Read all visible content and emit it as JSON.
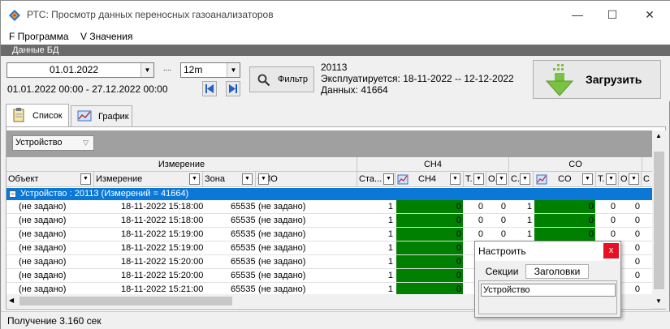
{
  "window": {
    "title": "РТС: Просмотр данных переносных газоанализаторов",
    "minimize": "—",
    "maximize": "☐",
    "close": "✕"
  },
  "menu": {
    "program": "F Программа",
    "values": "V Значения"
  },
  "section": {
    "title": "Данные БД"
  },
  "filter": {
    "date": "01.01.2022",
    "range_text": "01.01.2022 00:00 - 27.12.2022 00:00",
    "dots": "....",
    "period": "12m",
    "filter_label": "Фильтр"
  },
  "info": {
    "device": "20113",
    "exploit": "Эксплуатируется: 18-11-2022 -- 12-12-2022",
    "count": "Данных: 41664"
  },
  "load_button": {
    "label": "Загрузить"
  },
  "tabs": [
    {
      "label": "Список"
    },
    {
      "label": "График"
    }
  ],
  "grid": {
    "group_chip": "Устройство",
    "bands": {
      "measure": "Измерение",
      "ch4": "CH4",
      "co": "CO"
    },
    "columns": {
      "object": "Объект",
      "measure": "Измерение",
      "zone": "Зона",
      "fio": "ФИО",
      "status": "Ста...",
      "ch4": "CH4",
      "t": "T.",
      "o": "O.",
      "c": "C.",
      "co": "CO",
      "t2": "T.",
      "o2": "O",
      "c2": "C"
    },
    "group_row": "Устройство : 20113 (Измерений = 41664)",
    "rows": [
      {
        "object": "(не задано)",
        "time": "18-11-2022 15:18:00",
        "zone": "65535",
        "fio": "(не задано)",
        "st": "1",
        "ch4": "0",
        "t": "0",
        "o": "0",
        "c": "1",
        "co": "0",
        "t2": "0",
        "o2": "0"
      },
      {
        "object": "(не задано)",
        "time": "18-11-2022 15:18:00",
        "zone": "65535",
        "fio": "(не задано)",
        "st": "1",
        "ch4": "0",
        "t": "0",
        "o": "0",
        "c": "1",
        "co": "0",
        "t2": "0",
        "o2": "0"
      },
      {
        "object": "(не задано)",
        "time": "18-11-2022 15:19:00",
        "zone": "65535",
        "fio": "(не задано)",
        "st": "1",
        "ch4": "0",
        "t": "0",
        "o": "0",
        "c": "1",
        "co": "0",
        "t2": "0",
        "o2": "0"
      },
      {
        "object": "(не задано)",
        "time": "18-11-2022 15:19:00",
        "zone": "65535",
        "fio": "(не задано)",
        "st": "1",
        "ch4": "0",
        "t": "0",
        "o": "0",
        "c": "1",
        "co": "0",
        "t2": "0",
        "o2": "0"
      },
      {
        "object": "(не задано)",
        "time": "18-11-2022 15:20:00",
        "zone": "65535",
        "fio": "(не задано)",
        "st": "1",
        "ch4": "0",
        "t": "0",
        "o": "0",
        "c": "1",
        "co": "0",
        "t2": "0",
        "o2": "0"
      },
      {
        "object": "(не задано)",
        "time": "18-11-2022 15:20:00",
        "zone": "65535",
        "fio": "(не задано)",
        "st": "1",
        "ch4": "0",
        "t": "0",
        "o": "0",
        "c": "1",
        "co": "0",
        "t2": "0",
        "o2": "0"
      },
      {
        "object": "(не задано)",
        "time": "18-11-2022 15:21:00",
        "zone": "65535",
        "fio": "(не задано)",
        "st": "1",
        "ch4": "0",
        "t": "0",
        "o": "0",
        "c": "1",
        "co": "0",
        "t2": "0",
        "o2": "0"
      }
    ]
  },
  "status": {
    "text": "Получение 3.160 сек"
  },
  "popup": {
    "title": "Настроить",
    "close": "x",
    "tab_sections": "Секции",
    "tab_headers": "Заголовки",
    "item": "Устройство"
  },
  "colors": {
    "accent": "#0b78d8",
    "green_cell": "#008000",
    "close_red": "#e81123",
    "load_green": "#7bc142"
  }
}
